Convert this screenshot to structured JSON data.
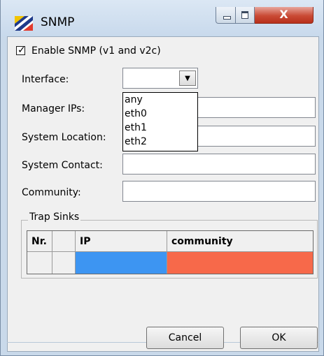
{
  "window": {
    "title": "SNMP",
    "close_glyph": "X"
  },
  "enable": {
    "label": "Enable SNMP (v1 and v2c)",
    "checked": true,
    "check_glyph": "✓"
  },
  "form": {
    "interface_label": "Interface:",
    "interface_value": "",
    "interface_arrow": "▼",
    "interface_options": [
      "any",
      "eth0",
      "eth1",
      "eth2"
    ],
    "manager_ips_label": "Manager IPs:",
    "manager_ips_value": "",
    "system_location_label": "System Location:",
    "system_location_value": "",
    "system_contact_label": "System Contact:",
    "system_contact_value": "",
    "community_label": "Community:",
    "community_value": ""
  },
  "trap_sinks": {
    "legend": "Trap Sinks",
    "columns": [
      "Nr.",
      "",
      "IP",
      "community"
    ],
    "ip_cell_color": "#3d95f2",
    "community_cell_color": "#f7694a"
  },
  "buttons": {
    "cancel": "Cancel",
    "ok": "OK"
  },
  "icons": {
    "app": "snmp-flag-icon",
    "minimize": "minimize-icon",
    "maximize": "maximize-icon",
    "close": "close-icon"
  }
}
